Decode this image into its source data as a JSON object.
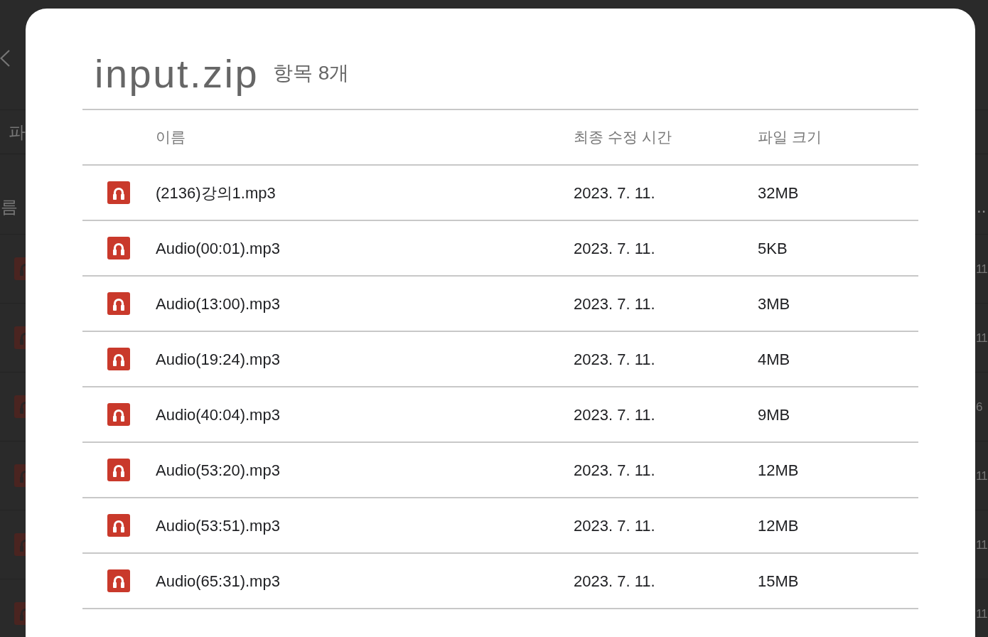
{
  "background": {
    "tab": "파",
    "column_header": "름",
    "header_end": "..",
    "rows": [
      {
        "trailing_text": "11"
      },
      {
        "trailing_text": "11"
      },
      {
        "trailing_text": "6"
      },
      {
        "trailing_text": "11"
      },
      {
        "trailing_text": "11"
      },
      {
        "trailing_text": "11"
      }
    ]
  },
  "dialog": {
    "title": "input.zip",
    "item_count": "항목 8개",
    "columns": [
      "이름",
      "최종 수정 시간",
      "파일 크기"
    ],
    "rows": [
      {
        "name": "(2136)강의1.mp3",
        "modified": "2023. 7. 11.",
        "size": "32MB"
      },
      {
        "name": "Audio(00:01).mp3",
        "modified": "2023. 7. 11.",
        "size": "5KB"
      },
      {
        "name": "Audio(13:00).mp3",
        "modified": "2023. 7. 11.",
        "size": "3MB"
      },
      {
        "name": "Audio(19:24).mp3",
        "modified": "2023. 7. 11.",
        "size": "4MB"
      },
      {
        "name": "Audio(40:04).mp3",
        "modified": "2023. 7. 11.",
        "size": "9MB"
      },
      {
        "name": "Audio(53:20).mp3",
        "modified": "2023. 7. 11.",
        "size": "12MB"
      },
      {
        "name": "Audio(53:51).mp3",
        "modified": "2023. 7. 11.",
        "size": "12MB"
      },
      {
        "name": "Audio(65:31).mp3",
        "modified": "2023. 7. 11.",
        "size": "15MB"
      }
    ]
  }
}
